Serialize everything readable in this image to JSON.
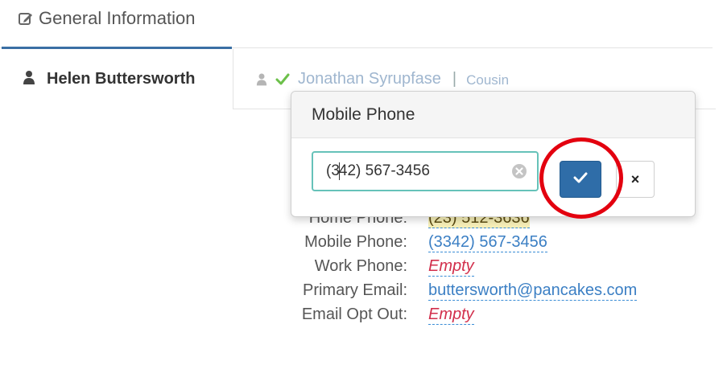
{
  "header": {
    "title": "General Information",
    "icon": "edit-icon"
  },
  "tabs": {
    "active": {
      "name": "Helen Buttersworth",
      "icon": "user-icon"
    },
    "inactive": {
      "name": "Jonathan Syrupfase",
      "separator": "|",
      "relation": "Cousin",
      "icons": [
        "user-icon",
        "check-icon"
      ]
    }
  },
  "popover": {
    "title": "Mobile Phone",
    "input_value_before_caret": "(3",
    "input_value_after_caret": "42) 567-3456",
    "clear_icon": "clear-circle-icon",
    "ok_icon": "check-icon",
    "cancel_label": "×"
  },
  "details": [
    {
      "label": "Home Phone:",
      "value": "(23) 512-3636"
    },
    {
      "label": "Mobile Phone:",
      "value": "(3342) 567-3456"
    },
    {
      "label": "Work Phone:",
      "value": "Empty"
    },
    {
      "label": "Primary Email:",
      "value": "buttersworth@pancakes.com"
    },
    {
      "label": "Email Opt Out:",
      "value": "Empty"
    }
  ],
  "colors": {
    "accent": "#3a6fa4",
    "link": "#3b7fc4",
    "empty": "#d22f4c",
    "input_focus": "#66c2b9",
    "primary_button": "#2f6da8",
    "annotation_ring": "#e3000f"
  }
}
